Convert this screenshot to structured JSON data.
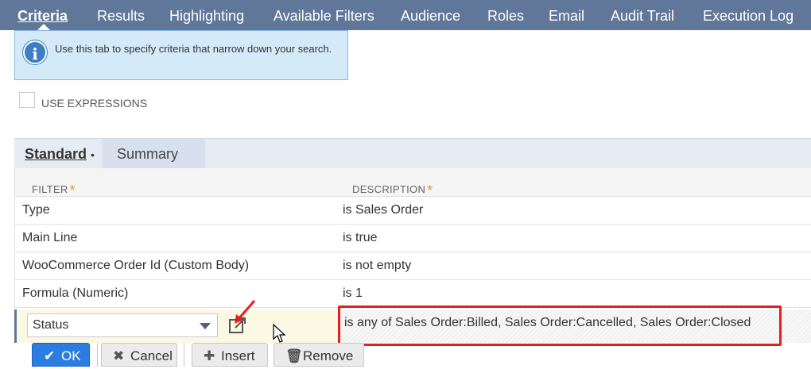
{
  "tabs": [
    {
      "label": "Criteria",
      "active": true
    },
    {
      "label": "Results"
    },
    {
      "label": "Highlighting"
    },
    {
      "label": "Available Filters"
    },
    {
      "label": "Audience"
    },
    {
      "label": "Roles"
    },
    {
      "label": "Email"
    },
    {
      "label": "Audit Trail"
    },
    {
      "label": "Execution Log"
    }
  ],
  "info": {
    "icon": "info-icon",
    "text": "Use this tab to specify criteria that narrow down your search."
  },
  "use_expressions": {
    "label": "USE EXPRESSIONS",
    "checked": false
  },
  "subtabs": [
    {
      "label": "Standard",
      "marker": "•",
      "active": true
    },
    {
      "label": "Summary"
    }
  ],
  "grid": {
    "headers": {
      "filter": "FILTER",
      "description": "DESCRIPTION",
      "required_mark": "*"
    },
    "rows": [
      {
        "filter": "Type",
        "description": "is Sales Order"
      },
      {
        "filter": "Main Line",
        "description": "is true"
      },
      {
        "filter": "WooCommerce Order Id (Custom Body)",
        "description": "is not empty"
      },
      {
        "filter": "Formula (Numeric)",
        "description": "is 1"
      }
    ]
  },
  "edit_row": {
    "filter_value": "Status",
    "description": "is any of Sales Order:Billed, Sales Order:Cancelled, Sales Order:Closed"
  },
  "buttons": {
    "ok": "OK",
    "cancel": "Cancel",
    "insert": "Insert",
    "remove": "Remove"
  },
  "colors": {
    "tabbar": "#607799",
    "primary_button": "#2b7de1",
    "annotation_red": "#e61e1e"
  }
}
